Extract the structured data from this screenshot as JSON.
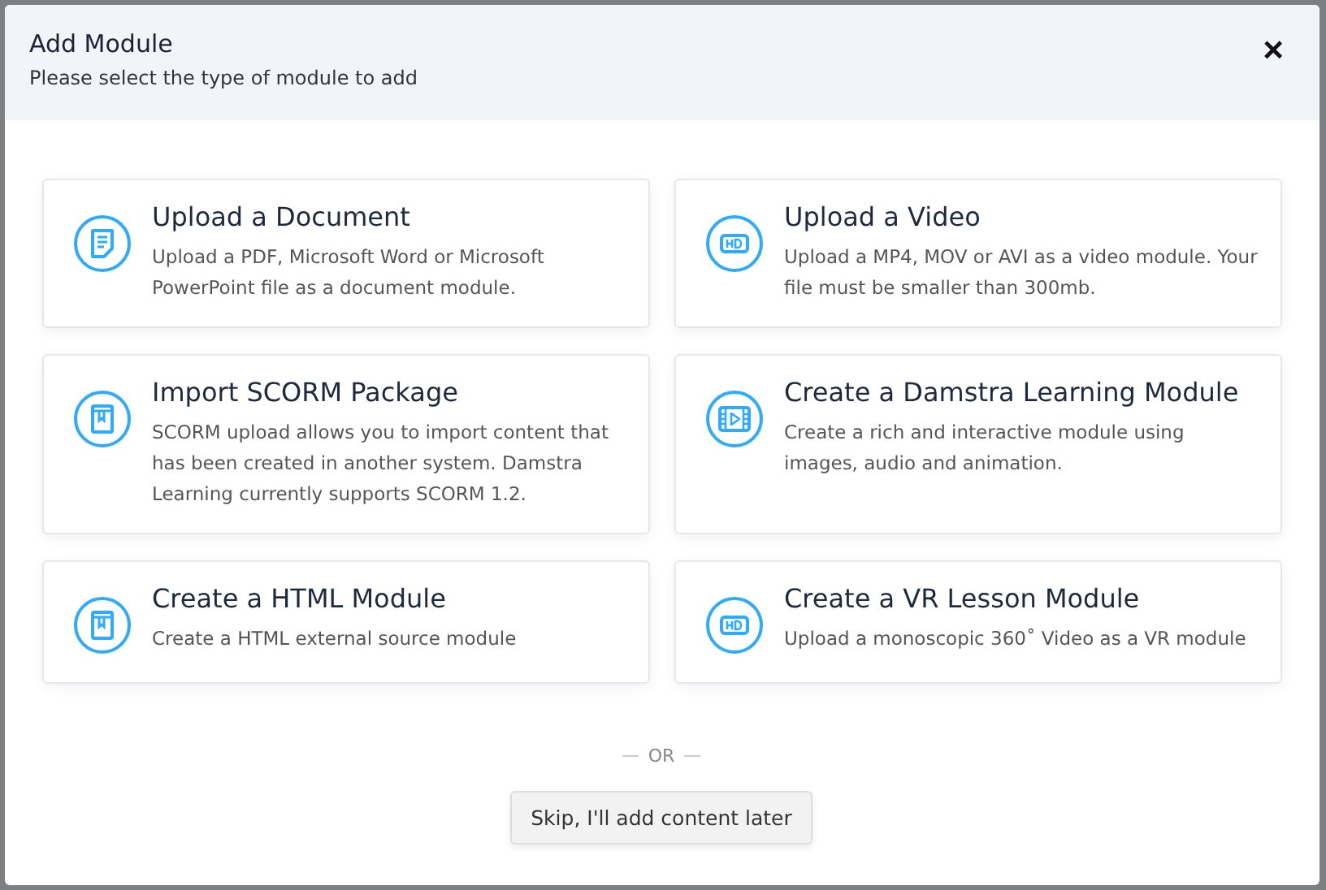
{
  "dialog": {
    "title": "Add Module",
    "subtitle": "Please select the type of module to add",
    "close": "×"
  },
  "options": [
    {
      "kind": "document",
      "title": "Upload a Document",
      "description": "Upload a PDF, Microsoft Word or Microsoft PowerPoint file as a document module."
    },
    {
      "kind": "hd",
      "title": "Upload a Video",
      "description": "Upload a MP4, MOV or AVI as a video module. Your file must be smaller than 300mb."
    },
    {
      "kind": "book",
      "title": "Import SCORM Package",
      "description": "SCORM upload allows you to import content that has been created in another system. Damstra Learning currently supports SCORM 1.2."
    },
    {
      "kind": "film",
      "title": "Create a Damstra Learning Module",
      "description": "Create a rich and interactive module using images, audio and animation."
    },
    {
      "kind": "book",
      "title": "Create a HTML Module",
      "description": "Create a HTML external source module"
    },
    {
      "kind": "hd",
      "title": "Create a VR Lesson Module",
      "description": "Upload a monoscopic 360˚ Video as a VR module"
    }
  ],
  "separator": "OR",
  "skip_button": "Skip, I'll add content later"
}
